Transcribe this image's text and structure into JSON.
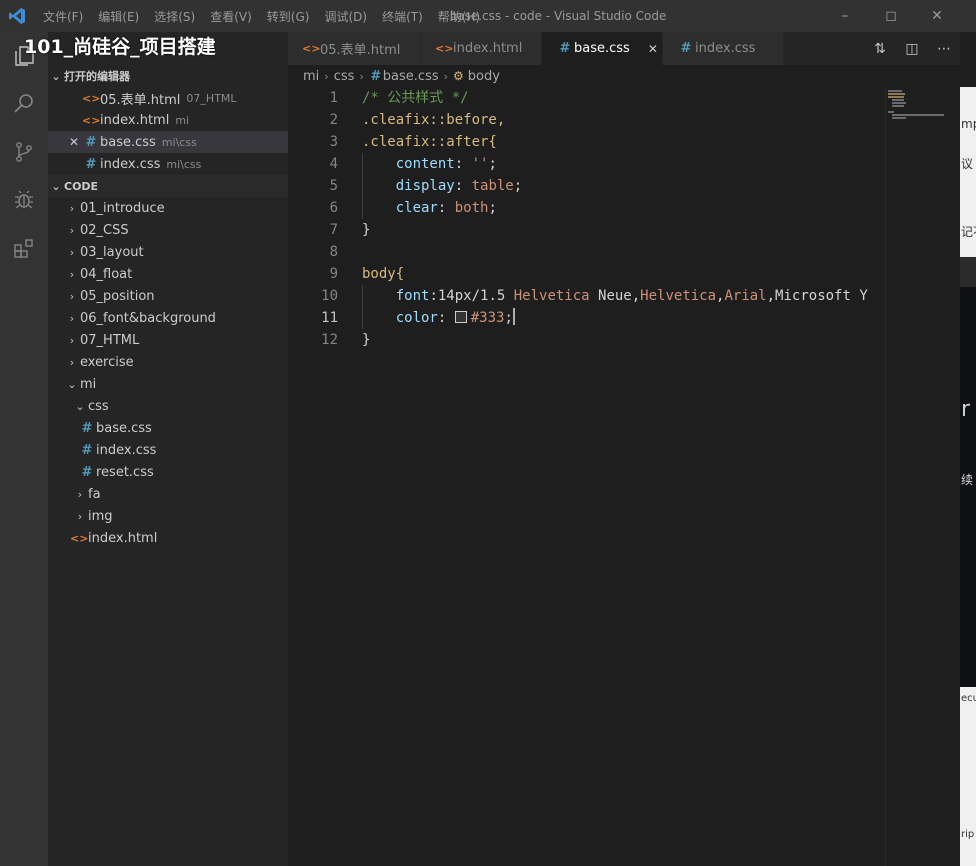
{
  "window": {
    "title": "base.css - code - Visual Studio Code",
    "menu": [
      "文件(F)",
      "编辑(E)",
      "选择(S)",
      "查看(V)",
      "转到(G)",
      "调试(D)",
      "终端(T)",
      "帮助(H)"
    ]
  },
  "video_title": "101_尚硅谷_项目搭建",
  "sidebar": {
    "open_editors_header": "打开的编辑器",
    "open_editors": [
      {
        "name": "05.表单.html",
        "desc": "07_HTML",
        "type": "html"
      },
      {
        "name": "index.html",
        "desc": "mi",
        "type": "html"
      },
      {
        "name": "base.css",
        "desc": "mi\\css",
        "type": "css"
      },
      {
        "name": "index.css",
        "desc": "mi\\css",
        "type": "css"
      }
    ],
    "folder_header": "CODE",
    "tree": [
      {
        "name": "01_introduce"
      },
      {
        "name": "02_CSS"
      },
      {
        "name": "03_layout"
      },
      {
        "name": "04_float"
      },
      {
        "name": "05_position"
      },
      {
        "name": "06_font&background"
      },
      {
        "name": "07_HTML"
      },
      {
        "name": "exercise"
      },
      {
        "name": "mi"
      },
      {
        "name": "css"
      },
      {
        "name": "base.css"
      },
      {
        "name": "index.css"
      },
      {
        "name": "reset.css"
      },
      {
        "name": "fa"
      },
      {
        "name": "img"
      },
      {
        "name": "index.html"
      }
    ]
  },
  "tabs": [
    {
      "label": "05.表单.html",
      "type": "html"
    },
    {
      "label": "index.html",
      "type": "html"
    },
    {
      "label": "base.css",
      "type": "css",
      "active": true
    },
    {
      "label": "index.css",
      "type": "css"
    }
  ],
  "breadcrumb": [
    "mi",
    "css",
    "base.css",
    "body"
  ],
  "editor": {
    "line_numbers": [
      "1",
      "2",
      "3",
      "4",
      "5",
      "6",
      "7",
      "8",
      "9",
      "10",
      "11",
      "12"
    ],
    "current_line": 11,
    "lines": {
      "l1": "/* 公共样式 */",
      "l2": ".cleafix::before,",
      "l3": ".cleafix::after{",
      "l4_prop": "content",
      "l4_val": "''",
      "l5_prop": "display",
      "l5_val": "table",
      "l6_prop": "clear",
      "l6_val": "both",
      "l7": "}",
      "l9": "body{",
      "l10_prop": "font",
      "l10_a": "14px/1.5 ",
      "l10_b": "Helvetica",
      "l10_c": " Neue,",
      "l10_d": "Helvetica",
      "l10_e": ",",
      "l10_f": "Arial",
      "l10_g": ",Microsoft Y",
      "l11_prop": "color",
      "l11_val": "#333",
      "l12": "}"
    }
  },
  "background_window_fragments": [
    "mp",
    "议",
    "记不",
    "r",
    "续",
    "ecu",
    "rip"
  ],
  "colors": {
    "comment": "#6a9955",
    "selector": "#d7ba7d",
    "property": "#9cdcfe",
    "value": "#ce9178",
    "html_icon": "#e37933",
    "css_icon": "#519aba",
    "swatch": "#333333"
  }
}
